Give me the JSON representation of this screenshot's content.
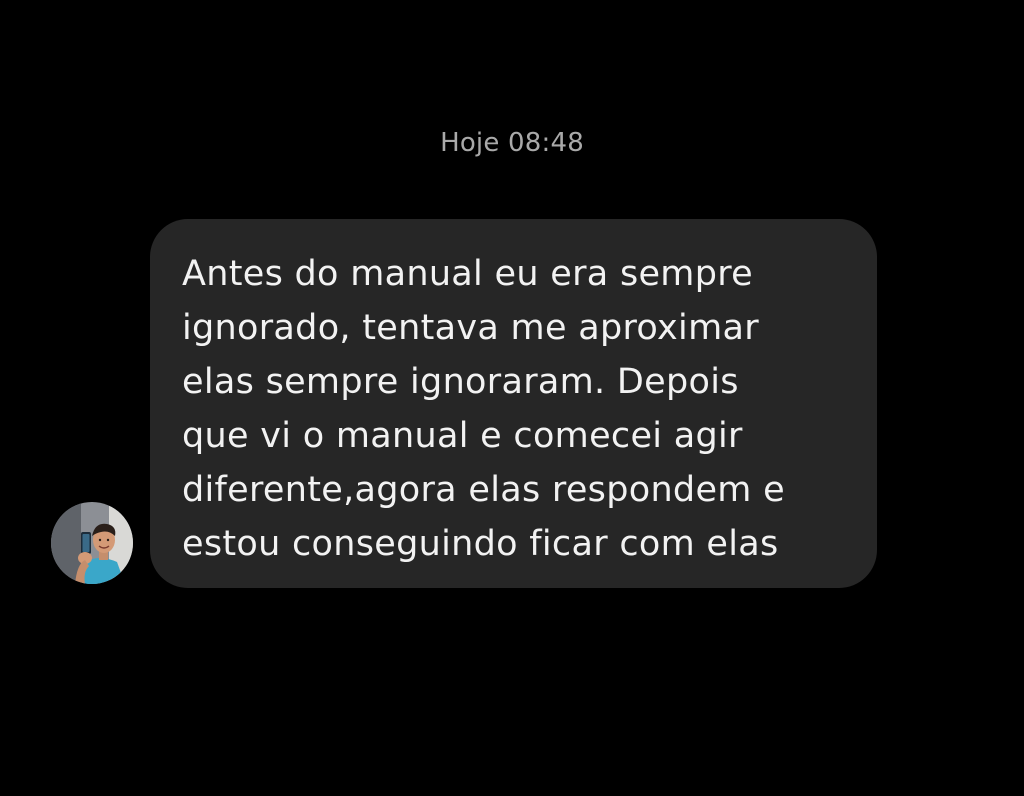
{
  "conversation": {
    "timestamp": "Hoje 08:48",
    "message": {
      "lines": [
        "Antes do manual eu era sempre",
        "ignorado, tentava me aproximar",
        "elas sempre ignoraram. Depois",
        "que vi o manual e comecei agir",
        "diferente,agora elas respondem e",
        "estou conseguindo ficar com elas"
      ]
    },
    "sender": {
      "avatar_icon": "profile-photo-avatar"
    }
  },
  "colors": {
    "background": "#000000",
    "bubble": "#262626",
    "message_text": "#f2f2f2",
    "timestamp_text": "#a9a9a9"
  }
}
